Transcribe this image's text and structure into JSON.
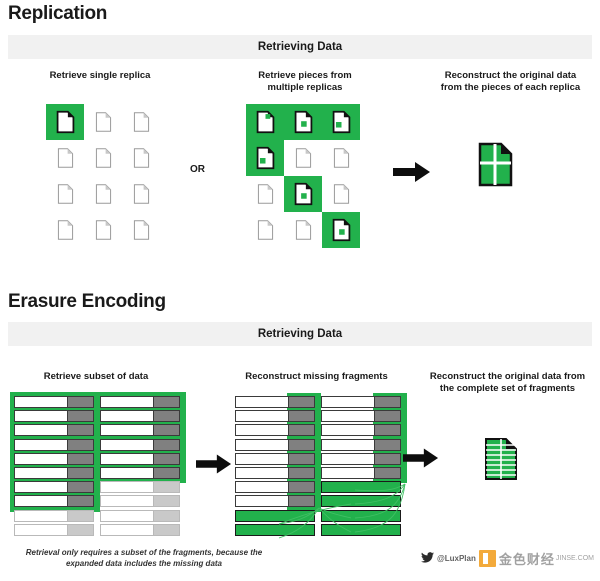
{
  "sections": [
    {
      "id": "replication",
      "title": "Replication",
      "band_label": "Retrieving Data",
      "captions": [
        "Retrieve single replica",
        "Retrieve pieces from\nmultiple replicas",
        "Reconstruct the original data\nfrom the pieces of each replica"
      ],
      "or_label": "OR",
      "grid_left": {
        "name": "single-replica-grid",
        "columns": 3,
        "rows": 4,
        "highlighted_cells": [
          0
        ]
      },
      "grid_middle": {
        "name": "multiple-replicas-grid",
        "columns": 3,
        "rows": 4,
        "highlighted_cells": [
          0,
          1,
          2,
          3,
          7,
          11
        ],
        "piece_positions": [
          "top-right",
          "center",
          "bottom-left",
          "bottom-left",
          "center",
          "center"
        ]
      },
      "result_icon": "reconstructed-document-quadrants"
    },
    {
      "id": "erasure",
      "title": "Erasure Encoding",
      "band_label": "Retrieving Data",
      "captions": [
        "Retrieve subset of data",
        "Reconstruct missing fragments",
        "Reconstruct the original data from\nthe complete set of fragments"
      ],
      "panel_left": {
        "name": "retrieved-subset-panel",
        "columns": [
          {
            "total_rows": 10,
            "retrieved_rows": 8
          },
          {
            "total_rows": 10,
            "retrieved_rows": 6
          }
        ]
      },
      "panel_middle": {
        "name": "reconstruct-fragments-panel",
        "columns": [
          {
            "total_rows": 10,
            "intact_rows": 8,
            "rebuilt_rows": 2
          },
          {
            "total_rows": 10,
            "intact_rows": 6,
            "rebuilt_rows": 4
          }
        ]
      },
      "result_icon": "reconstructed-document-striped",
      "footer_note": "Retrieval only requires a subset of the fragments, because the expanded data includes the missing data"
    }
  ],
  "watermark": {
    "twitter_icon": "twitter-bird-icon",
    "handle": "@LuxPlan",
    "logo": "orange-square-logo",
    "cjk_text": "金色财经",
    "cjk_subtext": "JINSE.COM"
  },
  "colors": {
    "green": "#22b14c",
    "band_gray": "#f1f1f1",
    "parity_gray": "#808080",
    "faded_gray": "#c9c9c9",
    "ink": "#1a1a1a"
  }
}
